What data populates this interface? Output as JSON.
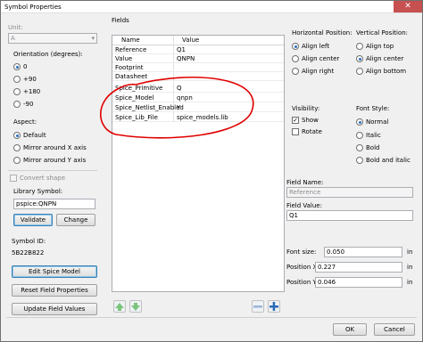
{
  "window": {
    "title": "Symbol Properties",
    "close": "✕"
  },
  "unit": {
    "label": "Unit:",
    "value": "A"
  },
  "orientation": {
    "label": "Orientation (degrees):",
    "options": [
      "0",
      "+90",
      "+180",
      "-90"
    ],
    "selected": "0"
  },
  "aspect": {
    "label": "Aspect:",
    "options": [
      "Default",
      "Mirror around X axis",
      "Mirror around Y axis"
    ],
    "selected": "Default"
  },
  "convert_shape": "Convert shape",
  "library_symbol": {
    "label": "Library Symbol:",
    "value": "pspice:QNPN",
    "validate": "Validate",
    "change": "Change"
  },
  "symbol_id": {
    "label": "Symbol ID:",
    "value": "5B22B822"
  },
  "buttons": {
    "edit_spice": "Edit Spice Model",
    "reset_fields": "Reset Field Properties",
    "update_fields": "Update Field Values"
  },
  "fields": {
    "label": "Fields",
    "headers": [
      "Name",
      "Value"
    ],
    "rows": [
      {
        "name": "Reference",
        "value": "Q1"
      },
      {
        "name": "Value",
        "value": "QNPN"
      },
      {
        "name": "Footprint",
        "value": ""
      },
      {
        "name": "Datasheet",
        "value": ""
      },
      {
        "name": "Spice_Primitive",
        "value": "Q"
      },
      {
        "name": "Spice_Model",
        "value": "qnpn"
      },
      {
        "name": "Spice_Netlist_Enabled",
        "value": "Y"
      },
      {
        "name": "Spice_Lib_File",
        "value": "spice_models.lib"
      }
    ]
  },
  "hpos": {
    "label": "Horizontal Position:",
    "options": [
      "Align left",
      "Align center",
      "Align right"
    ],
    "selected": "Align left"
  },
  "vpos": {
    "label": "Vertical Position:",
    "options": [
      "Align top",
      "Align center",
      "Align bottom"
    ],
    "selected": "Align center"
  },
  "visibility": {
    "label": "Visibility:",
    "show": "Show",
    "rotate": "Rotate",
    "show_checked": true,
    "rotate_checked": false
  },
  "font_style": {
    "label": "Font Style:",
    "options": [
      "Normal",
      "Italic",
      "Bold",
      "Bold and italic"
    ],
    "selected": "Normal"
  },
  "field_name": {
    "label": "Field Name:",
    "value": "Reference"
  },
  "field_value": {
    "label": "Field Value:",
    "value": "Q1"
  },
  "font_size": {
    "label": "Font size:",
    "value": "0.050",
    "unit": "in"
  },
  "pos_x": {
    "label": "Position X:",
    "value": "0.227",
    "unit": "in"
  },
  "pos_y": {
    "label": "Position Y:",
    "value": "0.046",
    "unit": "in"
  },
  "dialog": {
    "ok": "OK",
    "cancel": "Cancel"
  },
  "colors": {
    "annotation": "#e00000",
    "accent": "#2a6bb8"
  }
}
